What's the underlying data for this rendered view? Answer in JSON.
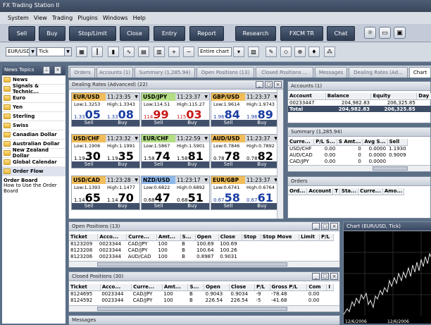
{
  "window_title": "FX Trading Station II",
  "menu": [
    "System",
    "View",
    "Trading",
    "Plugins",
    "Windows",
    "Help"
  ],
  "toolbar": {
    "sell": "Sell",
    "buy": "Buy",
    "stoplimit": "Stop/Limit",
    "close": "Close",
    "entry": "Entry",
    "report": "Report",
    "research": "Research",
    "fxcmtr": "FXCM TR",
    "chat": "Chat"
  },
  "chart_toolbar": {
    "symbol": "EUR/USD",
    "period": "Tick",
    "range": "Entire chart"
  },
  "news": {
    "title": "News Topics",
    "items": [
      "News",
      "Signals & Technic...",
      "Euro",
      "Yen",
      "Sterling",
      "Swiss",
      "Canadian Dollar",
      "Australian Dollar",
      "New Zealand Dollar",
      "Global Calendar",
      "Order Flow"
    ],
    "selected": "Order Flow",
    "sub": [
      "Order Board",
      "How to Use the Order Board"
    ]
  },
  "tabs": [
    "Orders",
    "Accounts (1)",
    "Summary (1,285.94)",
    "Open Positions (13)",
    "Closed Positions ...",
    "Messages",
    "Dealing Rates (Ad...",
    "Chart"
  ],
  "dealing": {
    "title": "Dealing Rates (Advanced) (22)",
    "sell": "Sell",
    "buy": "Buy",
    "tiles": [
      {
        "pair": "EUR/USD",
        "time": "11:23:35",
        "low": "Low:1.3253",
        "high": "High:1.3343",
        "bs": "1.33",
        "bb": "05",
        "as": "1.33",
        "ab": "08",
        "bd": "up",
        "ad": "up",
        "color": "orange"
      },
      {
        "pair": "USD/JPY",
        "time": "11:23:37",
        "low": "Low:114.51",
        "high": "High:115.27",
        "bs": "114",
        "bb": "99",
        "as": "115",
        "ab": "03",
        "bd": "dn",
        "ad": "dn",
        "color": "green"
      },
      {
        "pair": "GBP/USD",
        "time": "11:23:37",
        "low": "Low:1.9614",
        "high": "High:1.9743",
        "bs": "1.96",
        "bb": "84",
        "as": "1.96",
        "ab": "89",
        "bd": "up",
        "ad": "up",
        "color": "orange"
      },
      {
        "pair": "USD/CHF",
        "time": "11:23:32",
        "low": "Low:1.1906",
        "high": "High:1.1991",
        "bs": "1.19",
        "bb": "30",
        "as": "1.19",
        "ab": "35",
        "bd": "",
        "ad": "",
        "color": "orange"
      },
      {
        "pair": "EUR/CHF",
        "time": "11:22:59",
        "low": "Low:1.5867",
        "high": "High:1.5901",
        "bs": "1.58",
        "bb": "74",
        "as": "1.58",
        "ab": "81",
        "bd": "",
        "ad": "",
        "color": "green"
      },
      {
        "pair": "AUD/USD",
        "time": "11:23:37",
        "low": "Low:0.7846",
        "high": "High:0.7892",
        "bs": "0.78",
        "bb": "78",
        "as": "0.78",
        "ab": "82",
        "bd": "",
        "ad": "",
        "color": "orange"
      },
      {
        "pair": "USD/CAD",
        "time": "11:23:28",
        "low": "Low:1.1393",
        "high": "High:1.1477",
        "bs": "1.14",
        "bb": "65",
        "as": "1.14",
        "ab": "70",
        "bd": "",
        "ad": "",
        "color": "orange"
      },
      {
        "pair": "NZD/USD",
        "time": "11:23:17",
        "low": "Low:0.6822",
        "high": "High:0.6892",
        "bs": "0.68",
        "bb": "47",
        "as": "0.68",
        "ab": "51",
        "bd": "",
        "ad": "",
        "color": "blue"
      },
      {
        "pair": "EUR/GBP",
        "time": "11:23:37",
        "low": "Low:0.6741",
        "high": "High:0.6764",
        "bs": "0.67",
        "bb": "58",
        "as": "0.67",
        "ab": "61",
        "bd": "up",
        "ad": "up",
        "color": "orange"
      }
    ]
  },
  "accounts": {
    "title": "Accounts (1)",
    "cols": [
      "Account",
      "Balance",
      "Equity",
      "Day"
    ],
    "rows": [
      [
        "00233447",
        "204,982.83",
        "206,325.85",
        ""
      ],
      [
        "Total",
        "204,982.83",
        "206,325.85",
        ""
      ]
    ]
  },
  "summary": {
    "title": "Summary (1,285.94)",
    "cols": [
      "Curre...",
      "P/L S...",
      "S Amt...",
      "Avg S...",
      "Sell"
    ],
    "rows": [
      [
        "USD/CHF",
        "0.00",
        "0",
        "0.0000",
        "1.1930"
      ],
      [
        "AUD/CAD",
        "0.00",
        "0",
        "0.0000",
        "0.9009"
      ],
      [
        "CAD/JPY",
        "0.00",
        "0",
        "0.0000",
        ""
      ]
    ]
  },
  "orders": {
    "title": "Orders",
    "cols": [
      "Ord...",
      "Account",
      "T",
      "Sta...",
      "Curre...",
      "Amo..."
    ]
  },
  "open_positions": {
    "title": "Open Positions (13)",
    "cols": [
      "Ticket",
      "Acco...",
      "Curre...",
      "Amt...",
      "S...",
      "Open",
      "Close",
      "Stop",
      "Stop Move",
      "Limit",
      "P/L"
    ],
    "rows": [
      [
        "8123209",
        "0023344",
        "CAD/JPY",
        "100",
        "B",
        "100.69",
        "100.69",
        "",
        "",
        "",
        ""
      ],
      [
        "8123208",
        "0023344",
        "CAD/JPY",
        "100",
        "B",
        "100.64",
        "100.26",
        "",
        "",
        "",
        ""
      ],
      [
        "8123206",
        "0023344",
        "AUD/CAD",
        "100",
        "B",
        "0.8987",
        "0.9031",
        "",
        "",
        "",
        ""
      ]
    ]
  },
  "closed_positions": {
    "title": "Closed Positions (30)",
    "cols": [
      "Ticket",
      "Acco...",
      "Curre...",
      "Amt...",
      "S...",
      "Open",
      "Close",
      "P/L",
      "Gross P/L",
      "Com",
      "I"
    ],
    "rows": [
      [
        "8124695",
        "0023344",
        "CAD/JPY",
        "100",
        "B",
        "0.9043",
        "0.9034",
        "-9",
        "-78.48",
        "0.00",
        ""
      ],
      [
        "8124592",
        "0023344",
        "CAD/JPY",
        "100",
        "B",
        "226.54",
        "226.54",
        "-5",
        "-41.68",
        "0.00",
        ""
      ]
    ]
  },
  "chart": {
    "title": "Chart (EUR/USD, Tick)",
    "x_labels": [
      "12/6/2006",
      "12/6/2006"
    ]
  },
  "messages": {
    "title": "Messages"
  },
  "colors": {
    "orange": "#f0bd5a",
    "green": "#b4dd84",
    "blue": "#8fb8ea",
    "up": "#1a3da1",
    "down": "#c81818"
  }
}
